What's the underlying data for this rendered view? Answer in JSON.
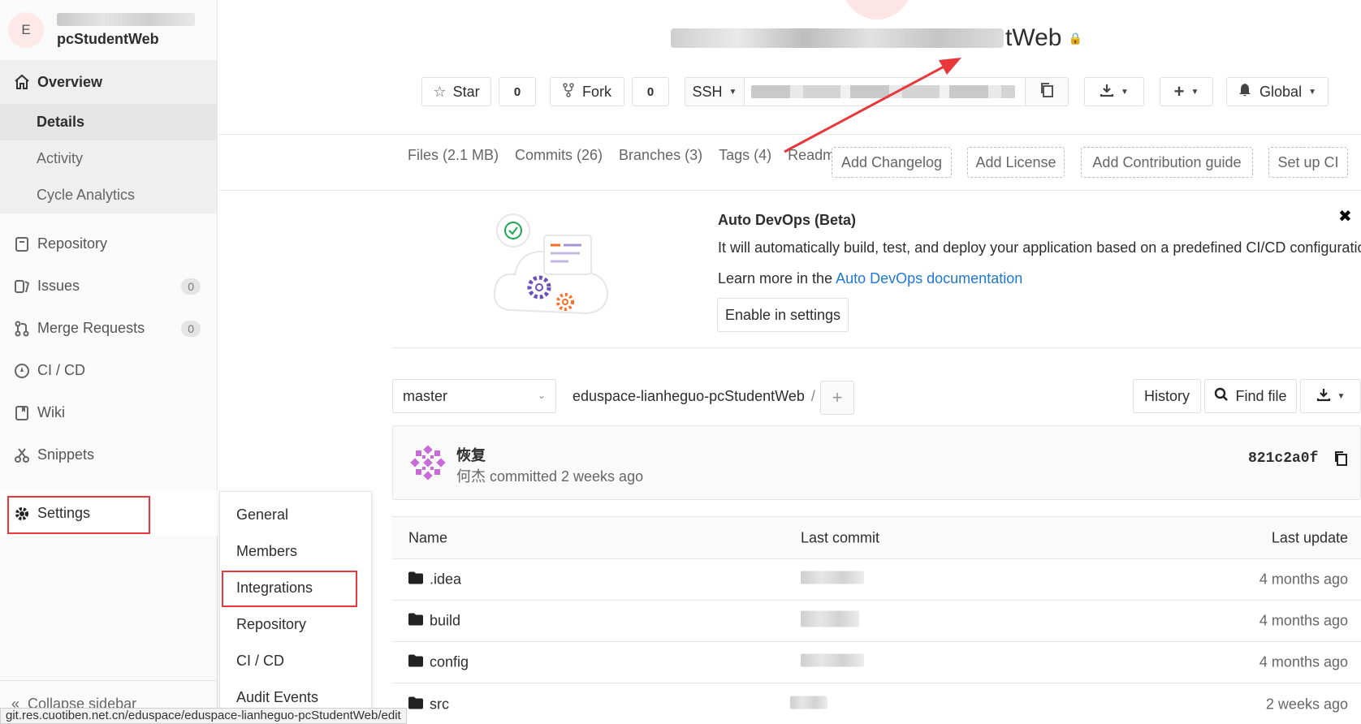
{
  "sidebar": {
    "avatar_letter": "E",
    "project_name": "pcStudentWeb",
    "overview_label": "Overview",
    "overview_sub": [
      "Details",
      "Activity",
      "Cycle Analytics"
    ],
    "repository_label": "Repository",
    "issues_label": "Issues",
    "issues_count": "0",
    "merge_requests_label": "Merge Requests",
    "merge_requests_count": "0",
    "cicd_label": "CI / CD",
    "wiki_label": "Wiki",
    "snippets_label": "Snippets",
    "settings_label": "Settings",
    "collapse_label": "Collapse sidebar"
  },
  "settings_flyout": [
    "General",
    "Members",
    "Integrations",
    "Repository",
    "CI / CD",
    "Audit Events"
  ],
  "header": {
    "title_visible": "tWeb",
    "star_label": "Star",
    "star_count": "0",
    "fork_label": "Fork",
    "fork_count": "0",
    "clone_protocol": "SSH",
    "notification_label": "Global"
  },
  "stats": {
    "files": "Files (2.1 MB)",
    "commits": "Commits (26)",
    "branches": "Branches (3)",
    "tags": "Tags (4)",
    "readme": "Readme",
    "add_changelog": "Add Changelog",
    "add_license": "Add License",
    "add_contribution": "Add Contribution guide",
    "setup_ci": "Set up CI"
  },
  "devops": {
    "title": "Auto DevOps (Beta)",
    "description": "It will automatically build, test, and deploy your application based on a predefined CI/CD configuration.",
    "learn_prefix": "Learn more in the ",
    "learn_link": "Auto DevOps documentation",
    "enable_label": "Enable in settings"
  },
  "repo": {
    "branch": "master",
    "path": "eduspace-lianheguo-pcStudentWeb",
    "path_sep": "/",
    "history_label": "History",
    "find_file_label": "Find file"
  },
  "commit": {
    "title": "恢复",
    "author": "何杰",
    "meta": " committed 2 weeks ago",
    "sha": "821c2a0f"
  },
  "files": {
    "headers": {
      "name": "Name",
      "last_commit": "Last commit",
      "last_update": "Last update"
    },
    "rows": [
      {
        "name": ".idea",
        "updated": "4 months ago"
      },
      {
        "name": "build",
        "updated": "4 months ago"
      },
      {
        "name": "config",
        "updated": "4 months ago"
      },
      {
        "name": "src",
        "updated": "2 weeks ago"
      }
    ]
  },
  "statusbar": "git.res.cuotiben.net.cn/eduspace/eduspace-lianheguo-pcStudentWeb/edit",
  "colors": {
    "highlight_red": "#e8383b",
    "link_blue": "#1f78d1",
    "sidebar_bg": "#fafafa"
  }
}
